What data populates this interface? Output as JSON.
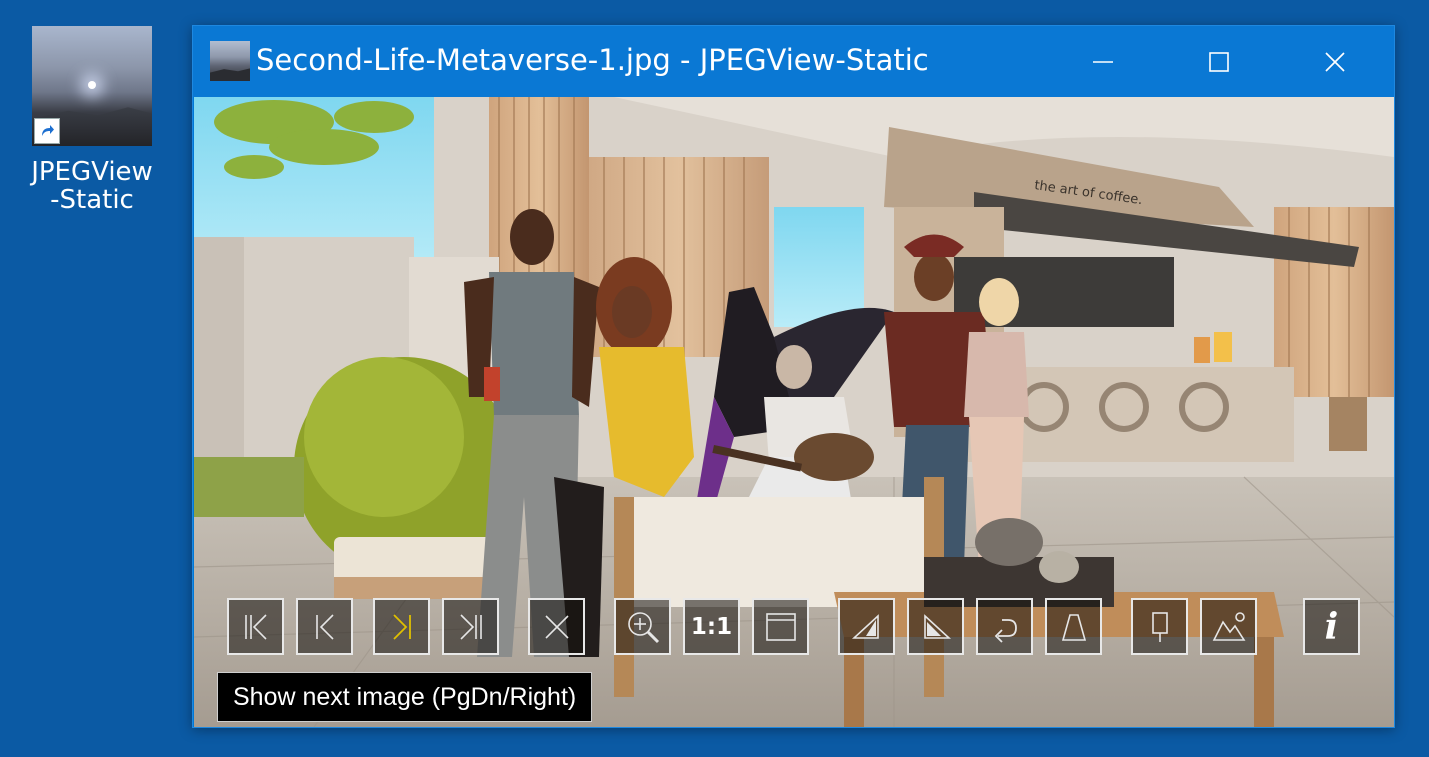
{
  "desktop": {
    "icon_label_line1": "JPEGView",
    "icon_label_line2": "-Static"
  },
  "window": {
    "title": "Second-Life-Metaverse-1.jpg - JPEGView-Static",
    "controls": {
      "minimize_icon": "minimize-icon",
      "maximize_icon": "maximize-icon",
      "close_icon": "close-icon"
    }
  },
  "image": {
    "sign_text": "the art of coffee."
  },
  "toolbar": {
    "buttons": [
      {
        "name": "first-image",
        "icon": "skip-to-first-icon"
      },
      {
        "name": "previous-image",
        "icon": "previous-icon"
      },
      {
        "name": "next-image",
        "icon": "next-icon"
      },
      {
        "name": "last-image",
        "icon": "skip-to-last-icon"
      },
      {
        "name": "delete-image",
        "icon": "cross-icon"
      },
      {
        "name": "zoom",
        "icon": "zoom-in-icon"
      },
      {
        "name": "actual-size",
        "label": "1:1"
      },
      {
        "name": "fit-window",
        "icon": "window-icon"
      },
      {
        "name": "rotate-right",
        "icon": "rotate-triangle-icon"
      },
      {
        "name": "rotate-left",
        "icon": "rotate-triangle-left-icon"
      },
      {
        "name": "undo",
        "icon": "undo-arrow-icon"
      },
      {
        "name": "perspective",
        "icon": "trapezoid-icon"
      },
      {
        "name": "crop-marker",
        "icon": "marker-icon"
      },
      {
        "name": "landscape",
        "icon": "landscape-icon"
      },
      {
        "name": "info",
        "label": "i"
      }
    ],
    "tooltip": "Show next image (PgDn/Right)"
  },
  "colors": {
    "desktop": "#0b5aa4",
    "titlebar": "#0a78d4",
    "next_icon_accent": "#e0c000"
  }
}
